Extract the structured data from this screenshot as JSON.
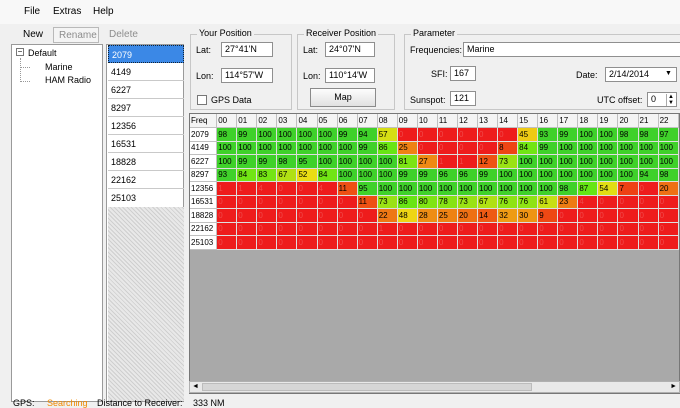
{
  "menu": {
    "file": "File",
    "extras": "Extras",
    "help": "Help"
  },
  "toolbar": {
    "new": "New",
    "rename": "Rename",
    "delete": "Delete"
  },
  "tree": {
    "root": "Default",
    "children": [
      "Marine",
      "HAM Radio"
    ]
  },
  "freq_list": [
    "2079",
    "4149",
    "6227",
    "8297",
    "12356",
    "16531",
    "18828",
    "22162",
    "25103"
  ],
  "selected_freq": "2079",
  "your_position": {
    "title": "Your Position",
    "lat_label": "Lat:",
    "lat": "27°41'N",
    "lon_label": "Lon:",
    "lon": "114°57'W",
    "gps_label": "GPS Data",
    "gps_checked": false
  },
  "receiver_position": {
    "title": "Receiver Position",
    "lat_label": "Lat:",
    "lat": "24°07'N",
    "lon_label": "Lon:",
    "lon": "110°14'W",
    "map_button": "Map"
  },
  "parameter": {
    "title": "Parameter",
    "freq_label": "Frequencies:",
    "freq_value": "Marine",
    "sfi_label": "SFI:",
    "sfi": "167",
    "sunspot_label": "Sunspot:",
    "sunspot": "121",
    "date_label": "Date:",
    "date": "2/14/2014",
    "utc_label": "UTC offset:",
    "utc": "0"
  },
  "grid": {
    "corner": "Freq",
    "hours": [
      "00",
      "01",
      "02",
      "03",
      "04",
      "05",
      "06",
      "07",
      "08",
      "09",
      "10",
      "11",
      "12",
      "13",
      "14",
      "15",
      "16",
      "17",
      "18",
      "19",
      "20",
      "21",
      "22"
    ],
    "rows": [
      {
        "freq": "2079",
        "values": [
          98,
          99,
          100,
          100,
          100,
          100,
          99,
          94,
          57,
          0,
          0,
          0,
          0,
          0,
          0,
          45,
          93,
          99,
          100,
          100,
          98,
          98,
          97
        ]
      },
      {
        "freq": "4149",
        "values": [
          100,
          100,
          100,
          100,
          100,
          100,
          100,
          99,
          86,
          25,
          0,
          0,
          0,
          0,
          8,
          84,
          99,
          100,
          100,
          100,
          100,
          100,
          100
        ]
      },
      {
        "freq": "6227",
        "values": [
          100,
          99,
          99,
          98,
          95,
          100,
          100,
          100,
          100,
          81,
          27,
          1,
          1,
          12,
          73,
          100,
          100,
          100,
          100,
          100,
          100,
          100,
          100
        ]
      },
      {
        "freq": "8297",
        "values": [
          93,
          84,
          83,
          67,
          52,
          84,
          100,
          100,
          100,
          99,
          99,
          96,
          96,
          99,
          100,
          100,
          100,
          100,
          100,
          100,
          100,
          94,
          98
        ]
      },
      {
        "freq": "12356",
        "values": [
          1,
          1,
          4,
          0,
          0,
          4,
          11,
          95,
          100,
          100,
          100,
          100,
          100,
          100,
          100,
          100,
          100,
          98,
          87,
          54,
          7,
          0,
          20
        ]
      },
      {
        "freq": "16531",
        "values": [
          0,
          0,
          0,
          0,
          0,
          0,
          0,
          11,
          73,
          86,
          80,
          78,
          73,
          67,
          76,
          76,
          61,
          23,
          4,
          0,
          0,
          0,
          0
        ]
      },
      {
        "freq": "18828",
        "values": [
          0,
          0,
          0,
          0,
          0,
          0,
          0,
          0,
          22,
          48,
          28,
          25,
          20,
          14,
          32,
          30,
          9,
          0,
          0,
          0,
          0,
          0,
          0
        ]
      },
      {
        "freq": "22162",
        "values": [
          0,
          0,
          0,
          0,
          0,
          0,
          0,
          0,
          1,
          0,
          0,
          0,
          0,
          0,
          0,
          0,
          0,
          0,
          0,
          0,
          0,
          0,
          0
        ]
      },
      {
        "freq": "25103",
        "values": [
          0,
          0,
          0,
          0,
          0,
          0,
          0,
          0,
          0,
          0,
          0,
          0,
          0,
          0,
          0,
          0,
          0,
          0,
          0,
          0,
          0,
          0,
          0
        ]
      }
    ]
  },
  "status": {
    "gps_label": "GPS:",
    "gps_value": "Searching",
    "dist_label": "Distance to Receiver:",
    "dist_value": "333 NM"
  },
  "colors": {
    "selection": "#3b88e6",
    "searching": "#f08a00",
    "bad": "#ee1c1c",
    "good": "#3fd12a"
  }
}
